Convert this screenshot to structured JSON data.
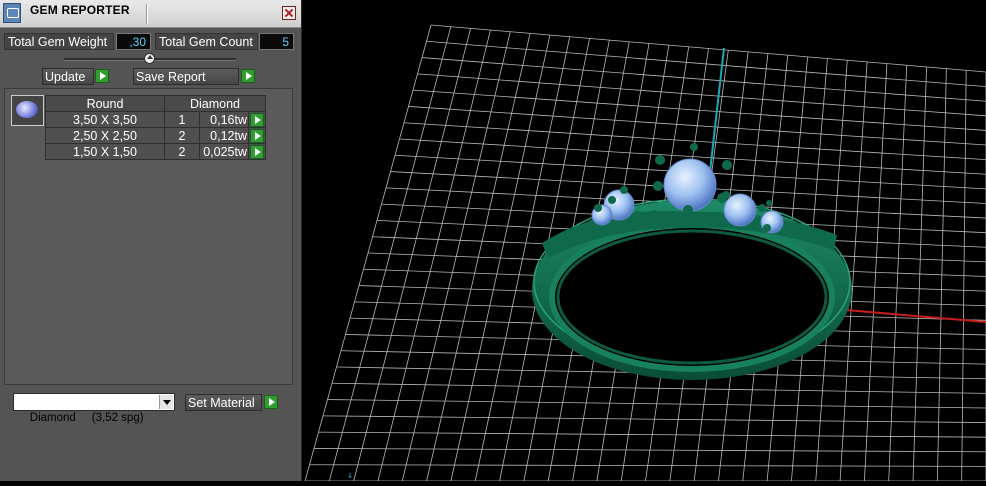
{
  "window": {
    "title": "GEM REPORTER"
  },
  "summary": {
    "weight_label": "Total Gem Weight",
    "weight_value": ",30",
    "count_label": "Total Gem Count",
    "count_value": "5"
  },
  "actions": {
    "update_label": "Update",
    "save_label": "Save Report"
  },
  "table": {
    "shape": "Round",
    "material": "Diamond",
    "rows": [
      {
        "size": "3,50 X 3,50",
        "qty": "1",
        "weight": "0,16tw"
      },
      {
        "size": "2,50 X 2,50",
        "qty": "2",
        "weight": "0,12tw"
      },
      {
        "size": "1,50 X 1,50",
        "qty": "2",
        "weight": "0,025tw"
      }
    ]
  },
  "material_select": {
    "value": "Diamond     (3,52 spg)"
  },
  "set_material_label": "Set Material",
  "colors": {
    "ring": "#0f6a4c",
    "gem": "#9ec1f0",
    "grid": "#b8b8b8",
    "axis_x": "#c81d1d",
    "axis_y": "#1fa6b8",
    "accent": "#2f9e2f"
  },
  "icons": [
    "app-icon",
    "close-icon",
    "arrow-right-icon",
    "slider-knob",
    "gem-thumbnail",
    "chevron-down-icon"
  ]
}
